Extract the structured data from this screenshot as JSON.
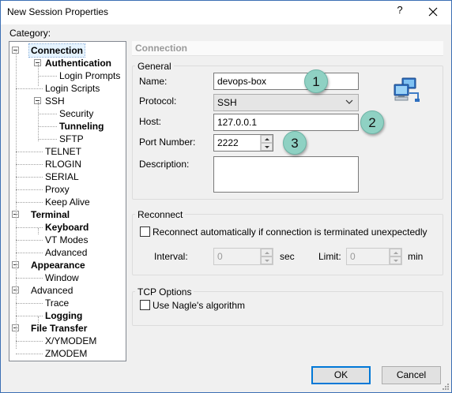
{
  "window": {
    "title": "New Session Properties",
    "help_label": "?",
    "close_icon": "close-icon"
  },
  "category": {
    "label": "Category:",
    "tree": [
      {
        "label": "Connection",
        "bold": true,
        "selected": true,
        "level": 0,
        "expander": true
      },
      {
        "label": "Authentication",
        "bold": true,
        "level": 1,
        "expander": true
      },
      {
        "label": "Login Prompts",
        "bold": false,
        "level": 2
      },
      {
        "label": "Login Scripts",
        "bold": false,
        "level": 1
      },
      {
        "label": "SSH",
        "bold": false,
        "level": 1,
        "expander": true
      },
      {
        "label": "Security",
        "bold": false,
        "level": 2
      },
      {
        "label": "Tunneling",
        "bold": true,
        "level": 2
      },
      {
        "label": "SFTP",
        "bold": false,
        "level": 2
      },
      {
        "label": "TELNET",
        "bold": false,
        "level": 1
      },
      {
        "label": "RLOGIN",
        "bold": false,
        "level": 1
      },
      {
        "label": "SERIAL",
        "bold": false,
        "level": 1
      },
      {
        "label": "Proxy",
        "bold": false,
        "level": 1
      },
      {
        "label": "Keep Alive",
        "bold": false,
        "level": 1
      },
      {
        "label": "Terminal",
        "bold": true,
        "level": 0,
        "expander": true
      },
      {
        "label": "Keyboard",
        "bold": true,
        "level": 1
      },
      {
        "label": "VT Modes",
        "bold": false,
        "level": 1
      },
      {
        "label": "Advanced",
        "bold": false,
        "level": 1
      },
      {
        "label": "Appearance",
        "bold": true,
        "level": 0,
        "expander": true
      },
      {
        "label": "Window",
        "bold": false,
        "level": 1
      },
      {
        "label": "Advanced",
        "bold": false,
        "level": 0,
        "expander": true
      },
      {
        "label": "Trace",
        "bold": false,
        "level": 1
      },
      {
        "label": "Logging",
        "bold": true,
        "level": 1
      },
      {
        "label": "File Transfer",
        "bold": true,
        "level": 0,
        "expander": true
      },
      {
        "label": "X/YMODEM",
        "bold": false,
        "level": 1
      },
      {
        "label": "ZMODEM",
        "bold": false,
        "level": 1
      }
    ]
  },
  "panel": {
    "header": "Connection",
    "general": {
      "group_label": "General",
      "name_label": "Name:",
      "name_value": "devops-box",
      "protocol_label": "Protocol:",
      "protocol_value": "SSH",
      "host_label": "Host:",
      "host_value": "127.0.0.1",
      "port_label": "Port Number:",
      "port_value": "2222",
      "description_label": "Description:",
      "description_value": "",
      "network_icon": "network-computers-icon"
    },
    "reconnect": {
      "group_label": "Reconnect",
      "checkbox_label": "Reconnect automatically if connection is terminated unexpectedly",
      "checked": false,
      "interval_label": "Interval:",
      "interval_value": "0",
      "interval_unit": "sec",
      "limit_label": "Limit:",
      "limit_value": "0",
      "limit_unit": "min"
    },
    "tcp": {
      "group_label": "TCP Options",
      "nagle_label": "Use Nagle's algorithm",
      "checked": false
    }
  },
  "annotations": {
    "badge1": "1",
    "badge2": "2",
    "badge3": "3",
    "badge_color": "#8fd1c3"
  },
  "buttons": {
    "ok": "OK",
    "cancel": "Cancel"
  }
}
